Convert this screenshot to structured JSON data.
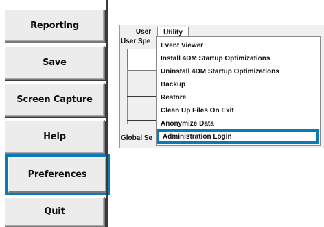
{
  "sidebar": {
    "buttons": [
      {
        "label": "Reporting"
      },
      {
        "label": "Save"
      },
      {
        "label": "Screen Capture"
      },
      {
        "label": "Help"
      },
      {
        "label": "Preferences"
      },
      {
        "label": "Quit"
      }
    ],
    "highlighted": "Preferences",
    "highlight_color": "#0a79b7"
  },
  "window": {
    "menu": {
      "user_label": "User",
      "utility_label": "Utility"
    },
    "user_spec_label": "User Spe",
    "global_label": "Global Se"
  },
  "utility_menu": {
    "items": [
      {
        "label": "Event Viewer"
      },
      {
        "label": "Install 4DM Startup Optimizations"
      },
      {
        "label": "Uninstall 4DM Startup Optimizations"
      },
      {
        "label": "Backup"
      },
      {
        "label": "Restore"
      },
      {
        "label": "Clean Up Files On Exit"
      },
      {
        "label": "Anonymize Data"
      },
      {
        "label": "Administration Login"
      }
    ],
    "highlighted": "Administration Login",
    "highlight_color": "#0a79b7"
  }
}
